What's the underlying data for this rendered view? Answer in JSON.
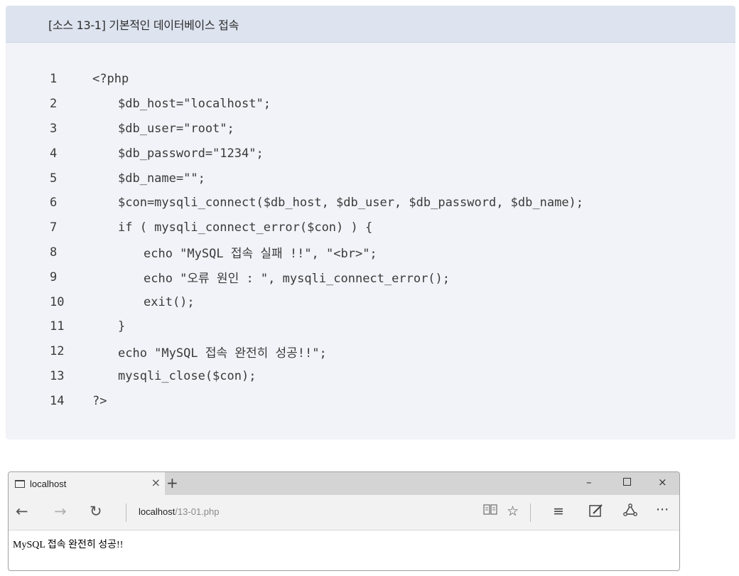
{
  "listing": {
    "title": "[소스 13-1] 기본적인 데이터베이스 접속",
    "lines": [
      {
        "num": "1",
        "indent": 0,
        "code": "<?php"
      },
      {
        "num": "2",
        "indent": 1,
        "code": "$db_host=\"localhost\";"
      },
      {
        "num": "3",
        "indent": 1,
        "code": "$db_user=\"root\";"
      },
      {
        "num": "4",
        "indent": 1,
        "code": "$db_password=\"1234\";"
      },
      {
        "num": "5",
        "indent": 1,
        "code": "$db_name=\"\";"
      },
      {
        "num": "6",
        "indent": 1,
        "code": "$con=mysqli_connect($db_host, $db_user, $db_password, $db_name);"
      },
      {
        "num": "7",
        "indent": 1,
        "code": "if ( mysqli_connect_error($con) ) {"
      },
      {
        "num": "8",
        "indent": 2,
        "code": "echo \"MySQL 접속 실패 !!\", \"<br>\";"
      },
      {
        "num": "9",
        "indent": 2,
        "code": "echo \"오류 원인 : \", mysqli_connect_error();"
      },
      {
        "num": "10",
        "indent": 2,
        "code": "exit();"
      },
      {
        "num": "11",
        "indent": 1,
        "code": "}"
      },
      {
        "num": "12",
        "indent": 1,
        "code": "echo \"MySQL 접속 완전히 성공!!\";"
      },
      {
        "num": "13",
        "indent": 1,
        "code": "mysqli_close($con);"
      },
      {
        "num": "14",
        "indent": 0,
        "code": "?>"
      }
    ]
  },
  "browser": {
    "tab_title": "localhost",
    "tab_close": "×",
    "new_tab": "+",
    "minimize": "–",
    "close": "×",
    "back": "←",
    "forward": "→",
    "refresh": "↻",
    "address_host": "localhost",
    "address_path": "/13-01.php",
    "reading_view": "📖",
    "favorite": "☆",
    "hub": "≡",
    "more": "···",
    "content_text": "MySQL 접속 완전히 성공!!"
  },
  "icons": {
    "tab": "page-icon",
    "reading_view": "book-icon",
    "favorite": "star-icon",
    "hub": "hub-icon",
    "note": "web-note-icon",
    "share": "share-icon",
    "more": "more-icon"
  }
}
